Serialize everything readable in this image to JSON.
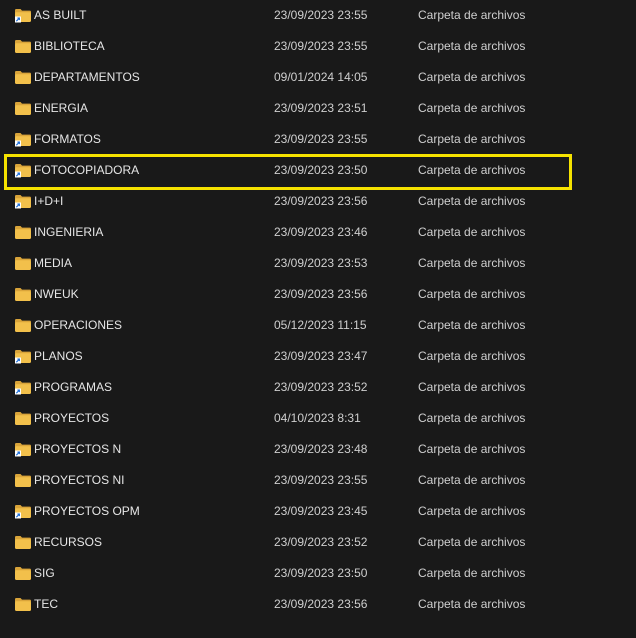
{
  "files": [
    {
      "name": "AS BUILT",
      "date": "23/09/2023 23:55",
      "type": "Carpeta de archivos",
      "shortcut": true
    },
    {
      "name": "BIBLIOTECA",
      "date": "23/09/2023 23:55",
      "type": "Carpeta de archivos",
      "shortcut": false
    },
    {
      "name": "DEPARTAMENTOS",
      "date": "09/01/2024 14:05",
      "type": "Carpeta de archivos",
      "shortcut": false
    },
    {
      "name": "ENERGIA",
      "date": "23/09/2023 23:51",
      "type": "Carpeta de archivos",
      "shortcut": false
    },
    {
      "name": "FORMATOS",
      "date": "23/09/2023 23:55",
      "type": "Carpeta de archivos",
      "shortcut": true
    },
    {
      "name": "FOTOCOPIADORA",
      "date": "23/09/2023 23:50",
      "type": "Carpeta de archivos",
      "shortcut": true,
      "highlighted": true
    },
    {
      "name": "I+D+I",
      "date": "23/09/2023 23:56",
      "type": "Carpeta de archivos",
      "shortcut": true
    },
    {
      "name": "INGENIERIA",
      "date": "23/09/2023 23:46",
      "type": "Carpeta de archivos",
      "shortcut": false
    },
    {
      "name": "MEDIA",
      "date": "23/09/2023 23:53",
      "type": "Carpeta de archivos",
      "shortcut": false
    },
    {
      "name": "NWEUK",
      "date": "23/09/2023 23:56",
      "type": "Carpeta de archivos",
      "shortcut": false
    },
    {
      "name": "OPERACIONES",
      "date": "05/12/2023 11:15",
      "type": "Carpeta de archivos",
      "shortcut": false
    },
    {
      "name": "PLANOS",
      "date": "23/09/2023 23:47",
      "type": "Carpeta de archivos",
      "shortcut": true
    },
    {
      "name": "PROGRAMAS",
      "date": "23/09/2023 23:52",
      "type": "Carpeta de archivos",
      "shortcut": true
    },
    {
      "name": "PROYECTOS",
      "date": "04/10/2023 8:31",
      "type": "Carpeta de archivos",
      "shortcut": false
    },
    {
      "name": "PROYECTOS N",
      "date": "23/09/2023 23:48",
      "type": "Carpeta de archivos",
      "shortcut": true
    },
    {
      "name": "PROYECTOS NI",
      "date": "23/09/2023 23:55",
      "type": "Carpeta de archivos",
      "shortcut": false
    },
    {
      "name": "PROYECTOS OPM",
      "date": "23/09/2023 23:45",
      "type": "Carpeta de archivos",
      "shortcut": true
    },
    {
      "name": "RECURSOS",
      "date": "23/09/2023 23:52",
      "type": "Carpeta de archivos",
      "shortcut": false
    },
    {
      "name": "SIG",
      "date": "23/09/2023 23:50",
      "type": "Carpeta de archivos",
      "shortcut": false
    },
    {
      "name": "TEC",
      "date": "23/09/2023 23:56",
      "type": "Carpeta de archivos",
      "shortcut": false
    }
  ],
  "colors": {
    "background": "#191919",
    "folder": "#f2c04b",
    "folder_dark": "#d9a43a",
    "highlight_border": "#f5e200",
    "shortcut_badge": "#ffffff",
    "shortcut_arrow": "#1e6fd9"
  },
  "icons": {
    "folder": "folder-icon",
    "shortcut": "shortcut-arrow-icon"
  }
}
